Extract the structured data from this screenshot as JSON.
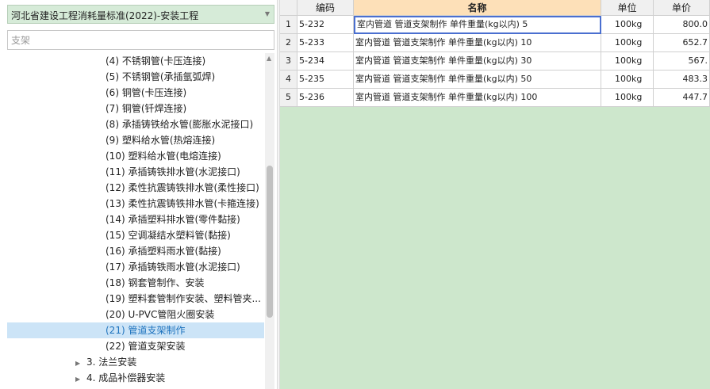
{
  "left_panel": {
    "standard_combo": "河北省建设工程消耗量标准(2022)-安装工程",
    "search_placeholder": "支架",
    "tree": {
      "children": [
        {
          "label": "(4) 不锈钢管(卡压连接)"
        },
        {
          "label": "(5) 不锈钢管(承插氩弧焊)"
        },
        {
          "label": "(6) 铜管(卡压连接)"
        },
        {
          "label": "(7) 铜管(钎焊连接)"
        },
        {
          "label": "(8) 承插铸铁给水管(膨胀水泥接口)"
        },
        {
          "label": "(9) 塑料给水管(热熔连接)"
        },
        {
          "label": "(10) 塑料给水管(电熔连接)"
        },
        {
          "label": "(11) 承插铸铁排水管(水泥接口)"
        },
        {
          "label": "(12) 柔性抗震铸铁排水管(柔性接口)"
        },
        {
          "label": "(13) 柔性抗震铸铁排水管(卡箍连接)"
        },
        {
          "label": "(14) 承插塑料排水管(零件黏接)"
        },
        {
          "label": "(15) 空调凝结水塑料管(黏接)"
        },
        {
          "label": "(16) 承插塑料雨水管(黏接)"
        },
        {
          "label": "(17) 承插铸铁雨水管(水泥接口)"
        },
        {
          "label": "(18) 钢套管制作、安装"
        },
        {
          "label": "(19) 塑料套管制作安装、塑料管夹..."
        },
        {
          "label": "(20) U-PVC管阻火圈安装"
        },
        {
          "label": "(21) 管道支架制作",
          "selected": true
        },
        {
          "label": "(22) 管道支架安装"
        }
      ],
      "parents": [
        {
          "label": "3. 法兰安装"
        },
        {
          "label": "4. 成品补偿器安装"
        }
      ]
    }
  },
  "grid": {
    "columns": [
      "编码",
      "名称",
      "单位",
      "单价"
    ],
    "rows": [
      {
        "index": "1",
        "code": "5-232",
        "name": "室内管道 管道支架制作 单件重量(kg以内) 5",
        "unit": "100kg",
        "price": "800.0"
      },
      {
        "index": "2",
        "code": "5-233",
        "name": "室内管道 管道支架制作 单件重量(kg以内) 10",
        "unit": "100kg",
        "price": "652.7"
      },
      {
        "index": "3",
        "code": "5-234",
        "name": "室内管道 管道支架制作 单件重量(kg以内) 30",
        "unit": "100kg",
        "price": "567."
      },
      {
        "index": "4",
        "code": "5-235",
        "name": "室内管道 管道支架制作 单件重量(kg以内) 50",
        "unit": "100kg",
        "price": "483.3"
      },
      {
        "index": "5",
        "code": "5-236",
        "name": "室内管道 管道支架制作 单件重量(kg以内) 100",
        "unit": "100kg",
        "price": "447.7"
      }
    ]
  },
  "colors": {
    "grid_background": "#cde7cc",
    "header_highlight": "#fde0b8",
    "tree_selected_bg": "#cce4f7",
    "tree_selected_text": "#1e73be",
    "active_cell_border": "#4a6fd0"
  },
  "icons": {
    "combo": "chevron-down-icon",
    "tree_collapsed": "triangle-right-icon",
    "scroll_up": "arrow-up-icon"
  }
}
